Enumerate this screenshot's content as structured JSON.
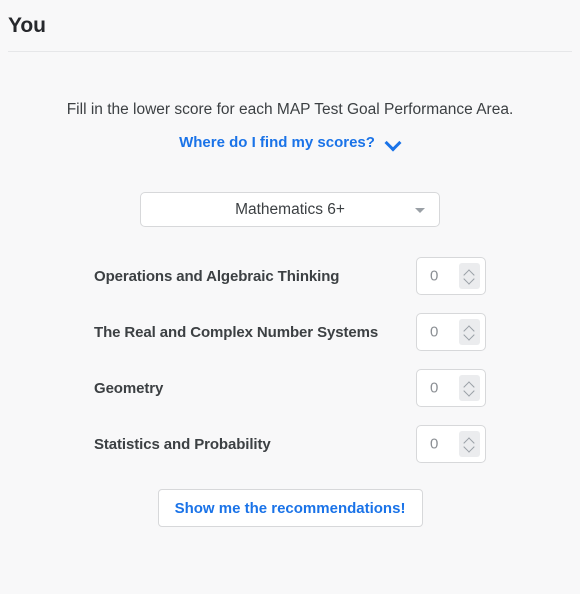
{
  "header": {
    "title": "You"
  },
  "intro": {
    "instruction": "Fill in the lower score for each MAP Test Goal Performance Area.",
    "help_link": "Where do I find my scores?",
    "help_chevron_icon": "chevron-down-icon"
  },
  "subject": {
    "selected": "Mathematics 6+",
    "caret_icon": "caret-down-icon"
  },
  "goals": [
    {
      "label": "Operations and Algebraic Thinking",
      "value": "0",
      "spinner_icon": "spinner-updown-icon"
    },
    {
      "label": "The Real and Complex Number Systems",
      "value": "0",
      "spinner_icon": "spinner-updown-icon"
    },
    {
      "label": "Geometry",
      "value": "0",
      "spinner_icon": "spinner-updown-icon"
    },
    {
      "label": "Statistics and Probability",
      "value": "0",
      "spinner_icon": "spinner-updown-icon"
    }
  ],
  "submit": {
    "label": "Show me the recommendations!"
  },
  "colors": {
    "accent": "#1a73e8",
    "background": "#f8f8f9",
    "text": "#3c4043",
    "border": "#d7d8da"
  }
}
